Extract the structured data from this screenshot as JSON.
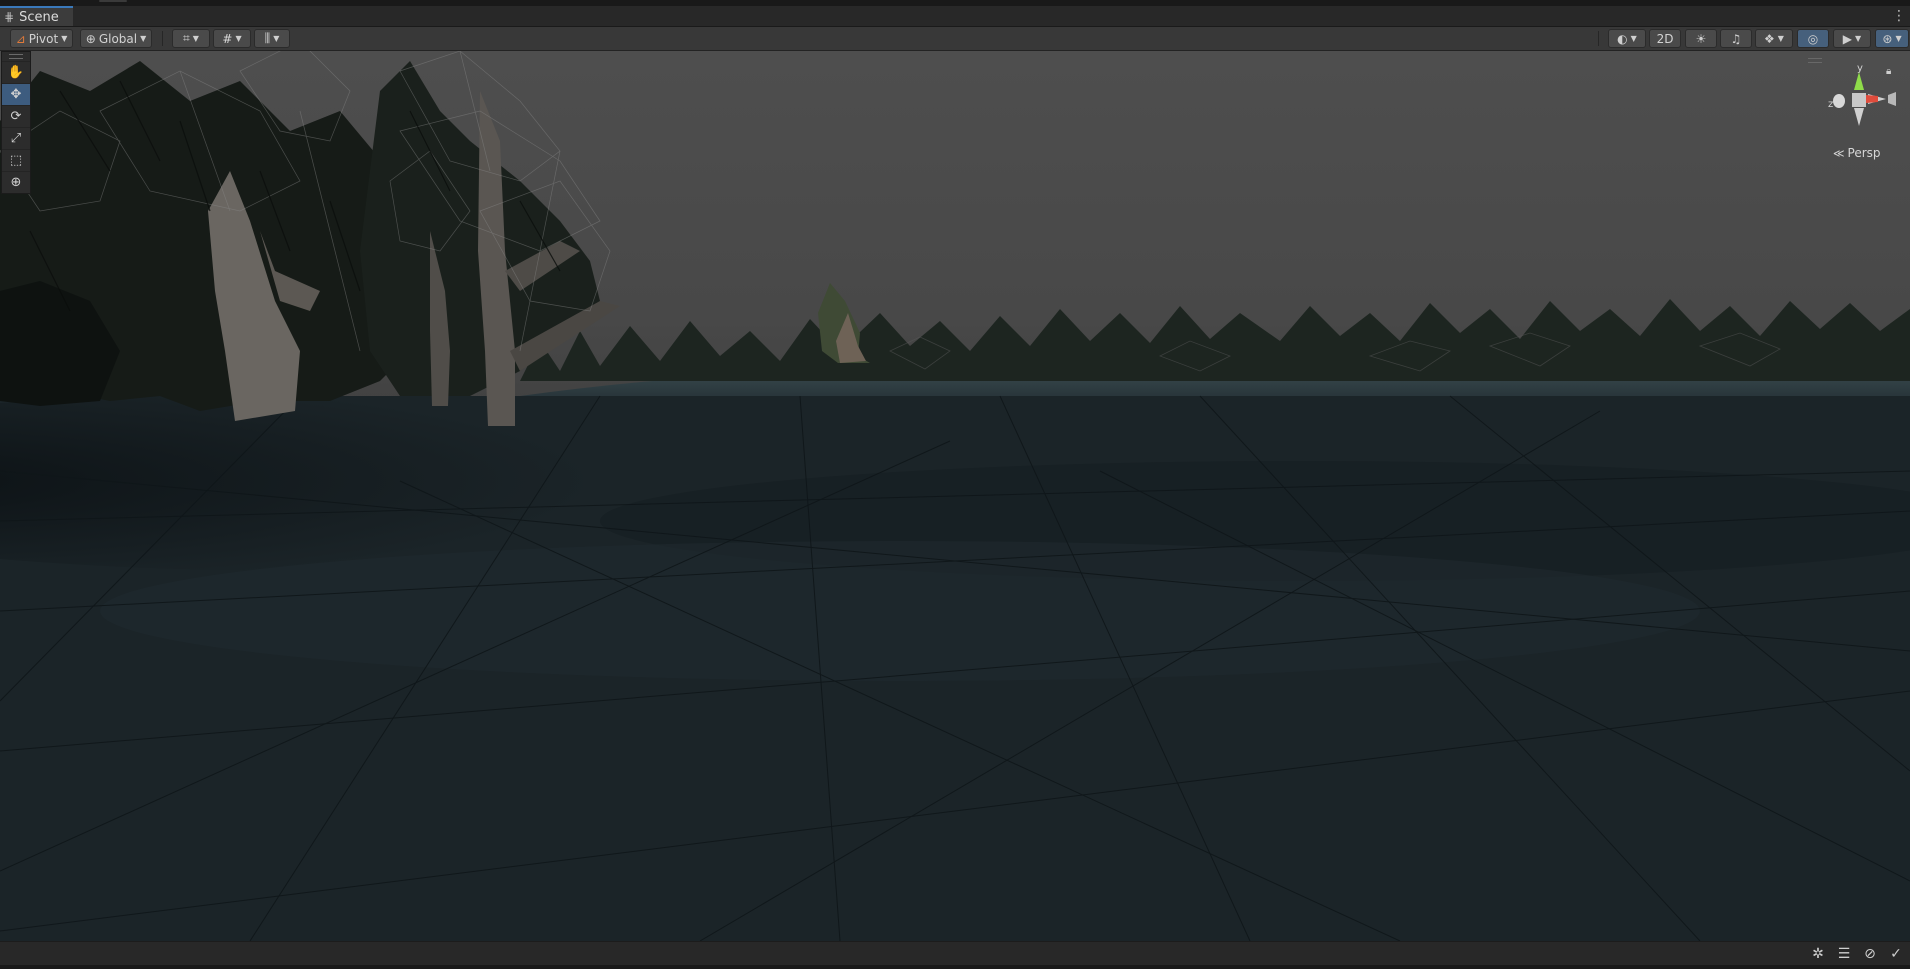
{
  "window": {
    "tab_title": "Scene",
    "tab_icon": "grid-icon",
    "menu_icon": "kebab-menu-icon"
  },
  "toolbar": {
    "pivot_label": "Pivot",
    "global_label": "Global",
    "mode_2d_label": "2D",
    "left_icons": [
      "pivot-icon",
      "global-icon",
      "snap-grid-icon",
      "grid-visibility-icon",
      "increment-snap-icon"
    ],
    "right_icons": [
      "draw-mode-icon",
      "lighting-icon",
      "audio-icon",
      "effects-icon",
      "scene-visibility-icon",
      "camera-icon",
      "gizmos-icon"
    ],
    "accent_color": "#3a79bb",
    "active_color": "#46607c"
  },
  "tools": {
    "items": [
      {
        "name": "hand-tool",
        "glyph": "✋"
      },
      {
        "name": "move-tool",
        "glyph": "✥",
        "active": true
      },
      {
        "name": "rotate-tool",
        "glyph": "⟳"
      },
      {
        "name": "scale-tool",
        "glyph": "⤢"
      },
      {
        "name": "rect-tool",
        "glyph": "⬚"
      },
      {
        "name": "transform-tool",
        "glyph": "⊕"
      }
    ]
  },
  "gizmo": {
    "y_label": "y",
    "z_label": "z",
    "projection_label": "Persp",
    "lock_icon": "lock-icon"
  },
  "statusbar": {
    "icons": [
      "debug-icon",
      "layers-icon",
      "hidden-icon",
      "check-icon"
    ]
  }
}
